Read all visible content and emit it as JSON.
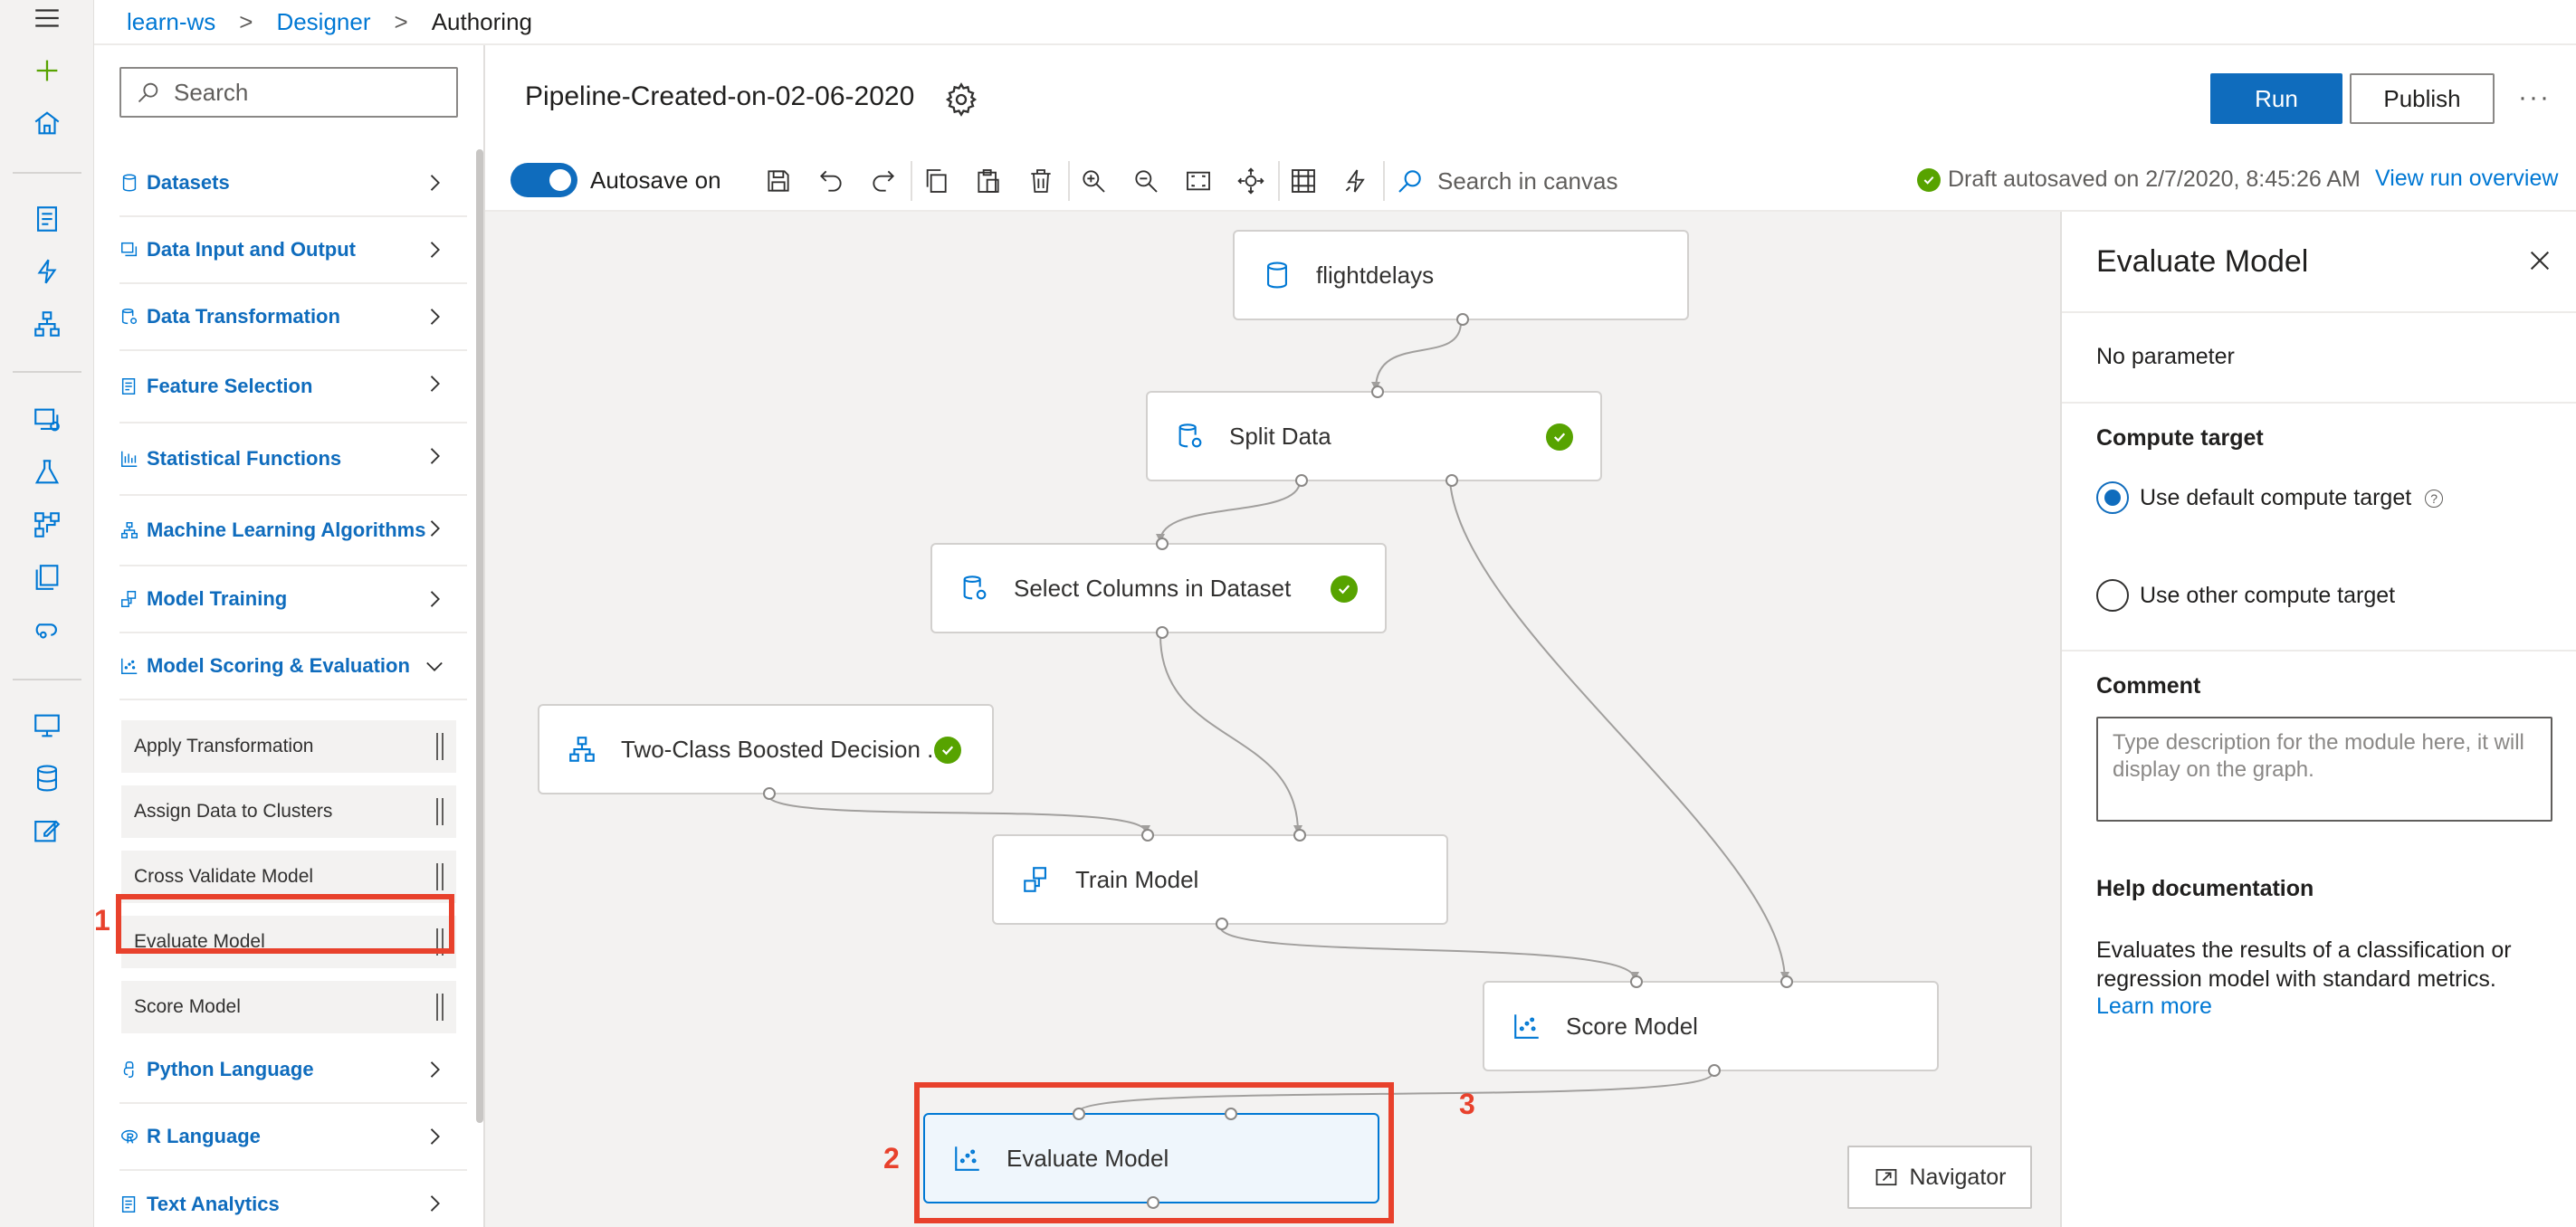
{
  "breadcrumb": {
    "workspace": "learn-ws",
    "designer": "Designer",
    "current": "Authoring",
    "sep": ">"
  },
  "rail_icons": [
    "menu-icon",
    "add-icon",
    "home-icon",
    "notebook-icon",
    "automl-icon",
    "designer-icon",
    "datasets-icon",
    "experiments-icon",
    "pipelines-icon",
    "models-icon",
    "endpoints-icon",
    "compute-icon",
    "datastores-icon",
    "labeling-icon"
  ],
  "palette": {
    "search_placeholder": "Search",
    "categories": [
      {
        "label": "Datasets",
        "icon": "database-icon"
      },
      {
        "label": "Data Input and Output",
        "icon": "data-io-icon"
      },
      {
        "label": "Data Transformation",
        "icon": "data-transform-icon"
      },
      {
        "label": "Feature Selection",
        "icon": "feature-selection-icon"
      },
      {
        "label": "Statistical Functions",
        "icon": "bar-chart-icon"
      },
      {
        "label": "Machine Learning Algorithms",
        "icon": "algorithm-icon"
      },
      {
        "label": "Model Training",
        "icon": "training-icon"
      },
      {
        "label": "Model Scoring & Evaluation",
        "icon": "scatter-icon"
      },
      {
        "label": "Python Language",
        "icon": "python-icon"
      },
      {
        "label": "R Language",
        "icon": "r-icon"
      },
      {
        "label": "Text Analytics",
        "icon": "text-icon"
      }
    ],
    "modules": [
      "Apply Transformation",
      "Assign Data to Clusters",
      "Cross Validate Model",
      "Evaluate Model",
      "Score Model"
    ]
  },
  "header": {
    "pipeline_title": "Pipeline-Created-on-02-06-2020",
    "run_label": "Run",
    "publish_label": "Publish",
    "more_label": "···"
  },
  "toolbar": {
    "autosave_label": "Autosave on",
    "autosave_on": true,
    "canvas_search_placeholder": "Search in canvas",
    "draft_status": "Draft autosaved on 2/7/2020, 8:45:26 AM",
    "view_run_overview": "View run overview"
  },
  "canvas": {
    "nodes": [
      {
        "label": "flightdelays",
        "icon": "dataset-icon",
        "completed": false
      },
      {
        "label": "Split Data",
        "icon": "data-transform-icon",
        "completed": true
      },
      {
        "label": "Select Columns in Dataset",
        "icon": "data-transform-icon",
        "completed": true
      },
      {
        "label": "Two-Class Boosted Decision ...",
        "icon": "algorithm-icon",
        "completed": true
      },
      {
        "label": "Train Model",
        "icon": "training-icon",
        "completed": false
      },
      {
        "label": "Score Model",
        "icon": "scatter-icon",
        "completed": false
      },
      {
        "label": "Evaluate Model",
        "icon": "scatter-icon",
        "completed": false,
        "selected": true
      }
    ],
    "navigator_label": "Navigator",
    "callouts": [
      "1",
      "2",
      "3"
    ]
  },
  "properties": {
    "title": "Evaluate Model",
    "no_parameter": "No parameter",
    "compute_target_heading": "Compute target",
    "use_default": "Use default compute target",
    "use_default_help": "?",
    "use_other": "Use other compute target",
    "selected_option": "default",
    "comment_heading": "Comment",
    "comment_placeholder": "Type description for the module here, it will display on the graph.",
    "help_heading": "Help documentation",
    "help_text": "Evaluates the results of a classification or regression model with standard metrics.",
    "learn_more": "Learn more"
  },
  "colors": {
    "accent": "#0f6cbd",
    "success": "#57a300",
    "callout": "#e8412c",
    "canvas_bg": "#f3f2f1"
  }
}
